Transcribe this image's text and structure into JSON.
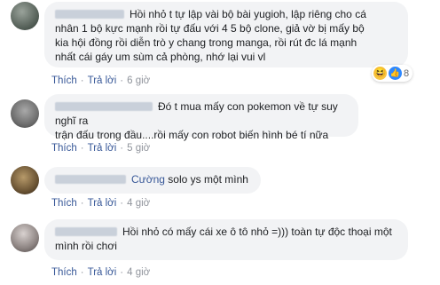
{
  "comments": [
    {
      "text": "Hồi nhỏ t tự lập vài bộ bài yugioh, lập riêng cho cá\nnhân 1 bộ kực mạnh rồi tự đấu với 4 5 bộ clone, giả vờ bị mấy bộ\nkia hội đồng rồi diễn trò y chang trong manga, rồi rút đc lá mạnh\nnhất cái gáy um sùm cả phòng, nhớ lại vui vl",
      "like": "Thích",
      "reply": "Trả lời",
      "time": "6 giờ",
      "reaction_count": "8",
      "reaction_icons": [
        "haha-icon",
        "like-icon"
      ]
    },
    {
      "text": "Đó t mua mấy con pokemon về tự suy nghĩ ra\ntrận đấu trong đầu....rồi mấy con robot biến hình bé tí nữa",
      "like": "Thích",
      "reply": "Trả lời",
      "time": "5 giờ"
    },
    {
      "mention": "Cường",
      "text": "solo ys một mình",
      "like": "Thích",
      "reply": "Trả lời",
      "time": "4 giờ"
    },
    {
      "text": "Hồi nhỏ có mấy cái xe ô tô nhỏ =))) toàn tự độc thoại một\nmình rồi chơi",
      "like": "Thích",
      "reply": "Trả lời",
      "time": "4 giờ"
    }
  ],
  "colors": {
    "bubble": "#f2f3f5",
    "link": "#385898",
    "meta": "#90949c"
  }
}
